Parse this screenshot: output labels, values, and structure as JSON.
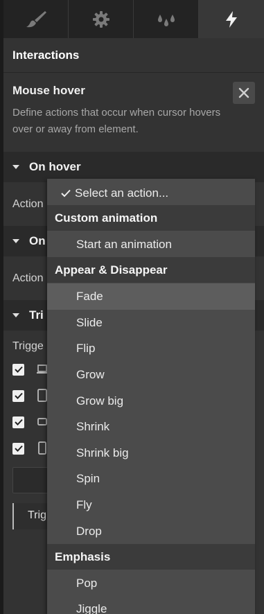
{
  "tabs": [
    {
      "icon": "brush-icon"
    },
    {
      "icon": "gear-icon"
    },
    {
      "icon": "drops-icon"
    },
    {
      "icon": "lightning-icon",
      "active": true
    }
  ],
  "panel": {
    "title": "Interactions",
    "hover_section": {
      "title": "Mouse hover",
      "description": "Define actions that occur when cursor hovers over or away from element."
    },
    "groups": {
      "on_hover": "On hover",
      "on_away": "On",
      "triggers": "Tri"
    },
    "action_label": "Action",
    "action_label_2": "Action",
    "trigger_label": "Trigge",
    "trigger_button": "Trig"
  },
  "dropdown": {
    "selected": "Select an action...",
    "sections": [
      {
        "category": "Custom animation",
        "items": [
          "Start an animation"
        ]
      },
      {
        "category": "Appear & Disappear",
        "items": [
          "Fade",
          "Slide",
          "Flip",
          "Grow",
          "Grow big",
          "Shrink",
          "Shrink big",
          "Spin",
          "Fly",
          "Drop"
        ]
      },
      {
        "category": "Emphasis",
        "items": [
          "Pop",
          "Jiggle"
        ]
      }
    ],
    "highlighted": "Fade"
  }
}
